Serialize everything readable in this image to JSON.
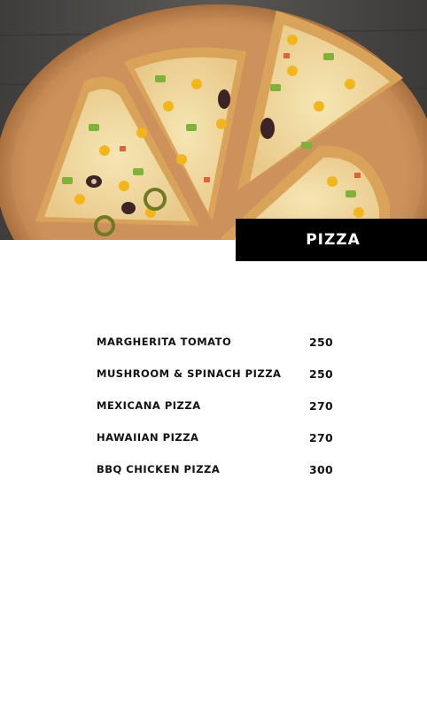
{
  "header": {
    "category_title": "PIZZA",
    "hero_image": "pizza-on-wooden-board"
  },
  "menu": {
    "items": [
      {
        "name": "MARGHERITA TOMATO",
        "price": "250"
      },
      {
        "name": "MUSHROOM & SPINACH PIZZA",
        "price": "250"
      },
      {
        "name": "MEXICANA PIZZA",
        "price": "270"
      },
      {
        "name": "HAWAIIAN PIZZA",
        "price": "270"
      },
      {
        "name": "BBQ CHICKEN PIZZA",
        "price": "300"
      }
    ]
  },
  "colors": {
    "tag_background": "#000000",
    "tag_text": "#ffffff",
    "text": "#111111",
    "page_background": "#ffffff"
  }
}
